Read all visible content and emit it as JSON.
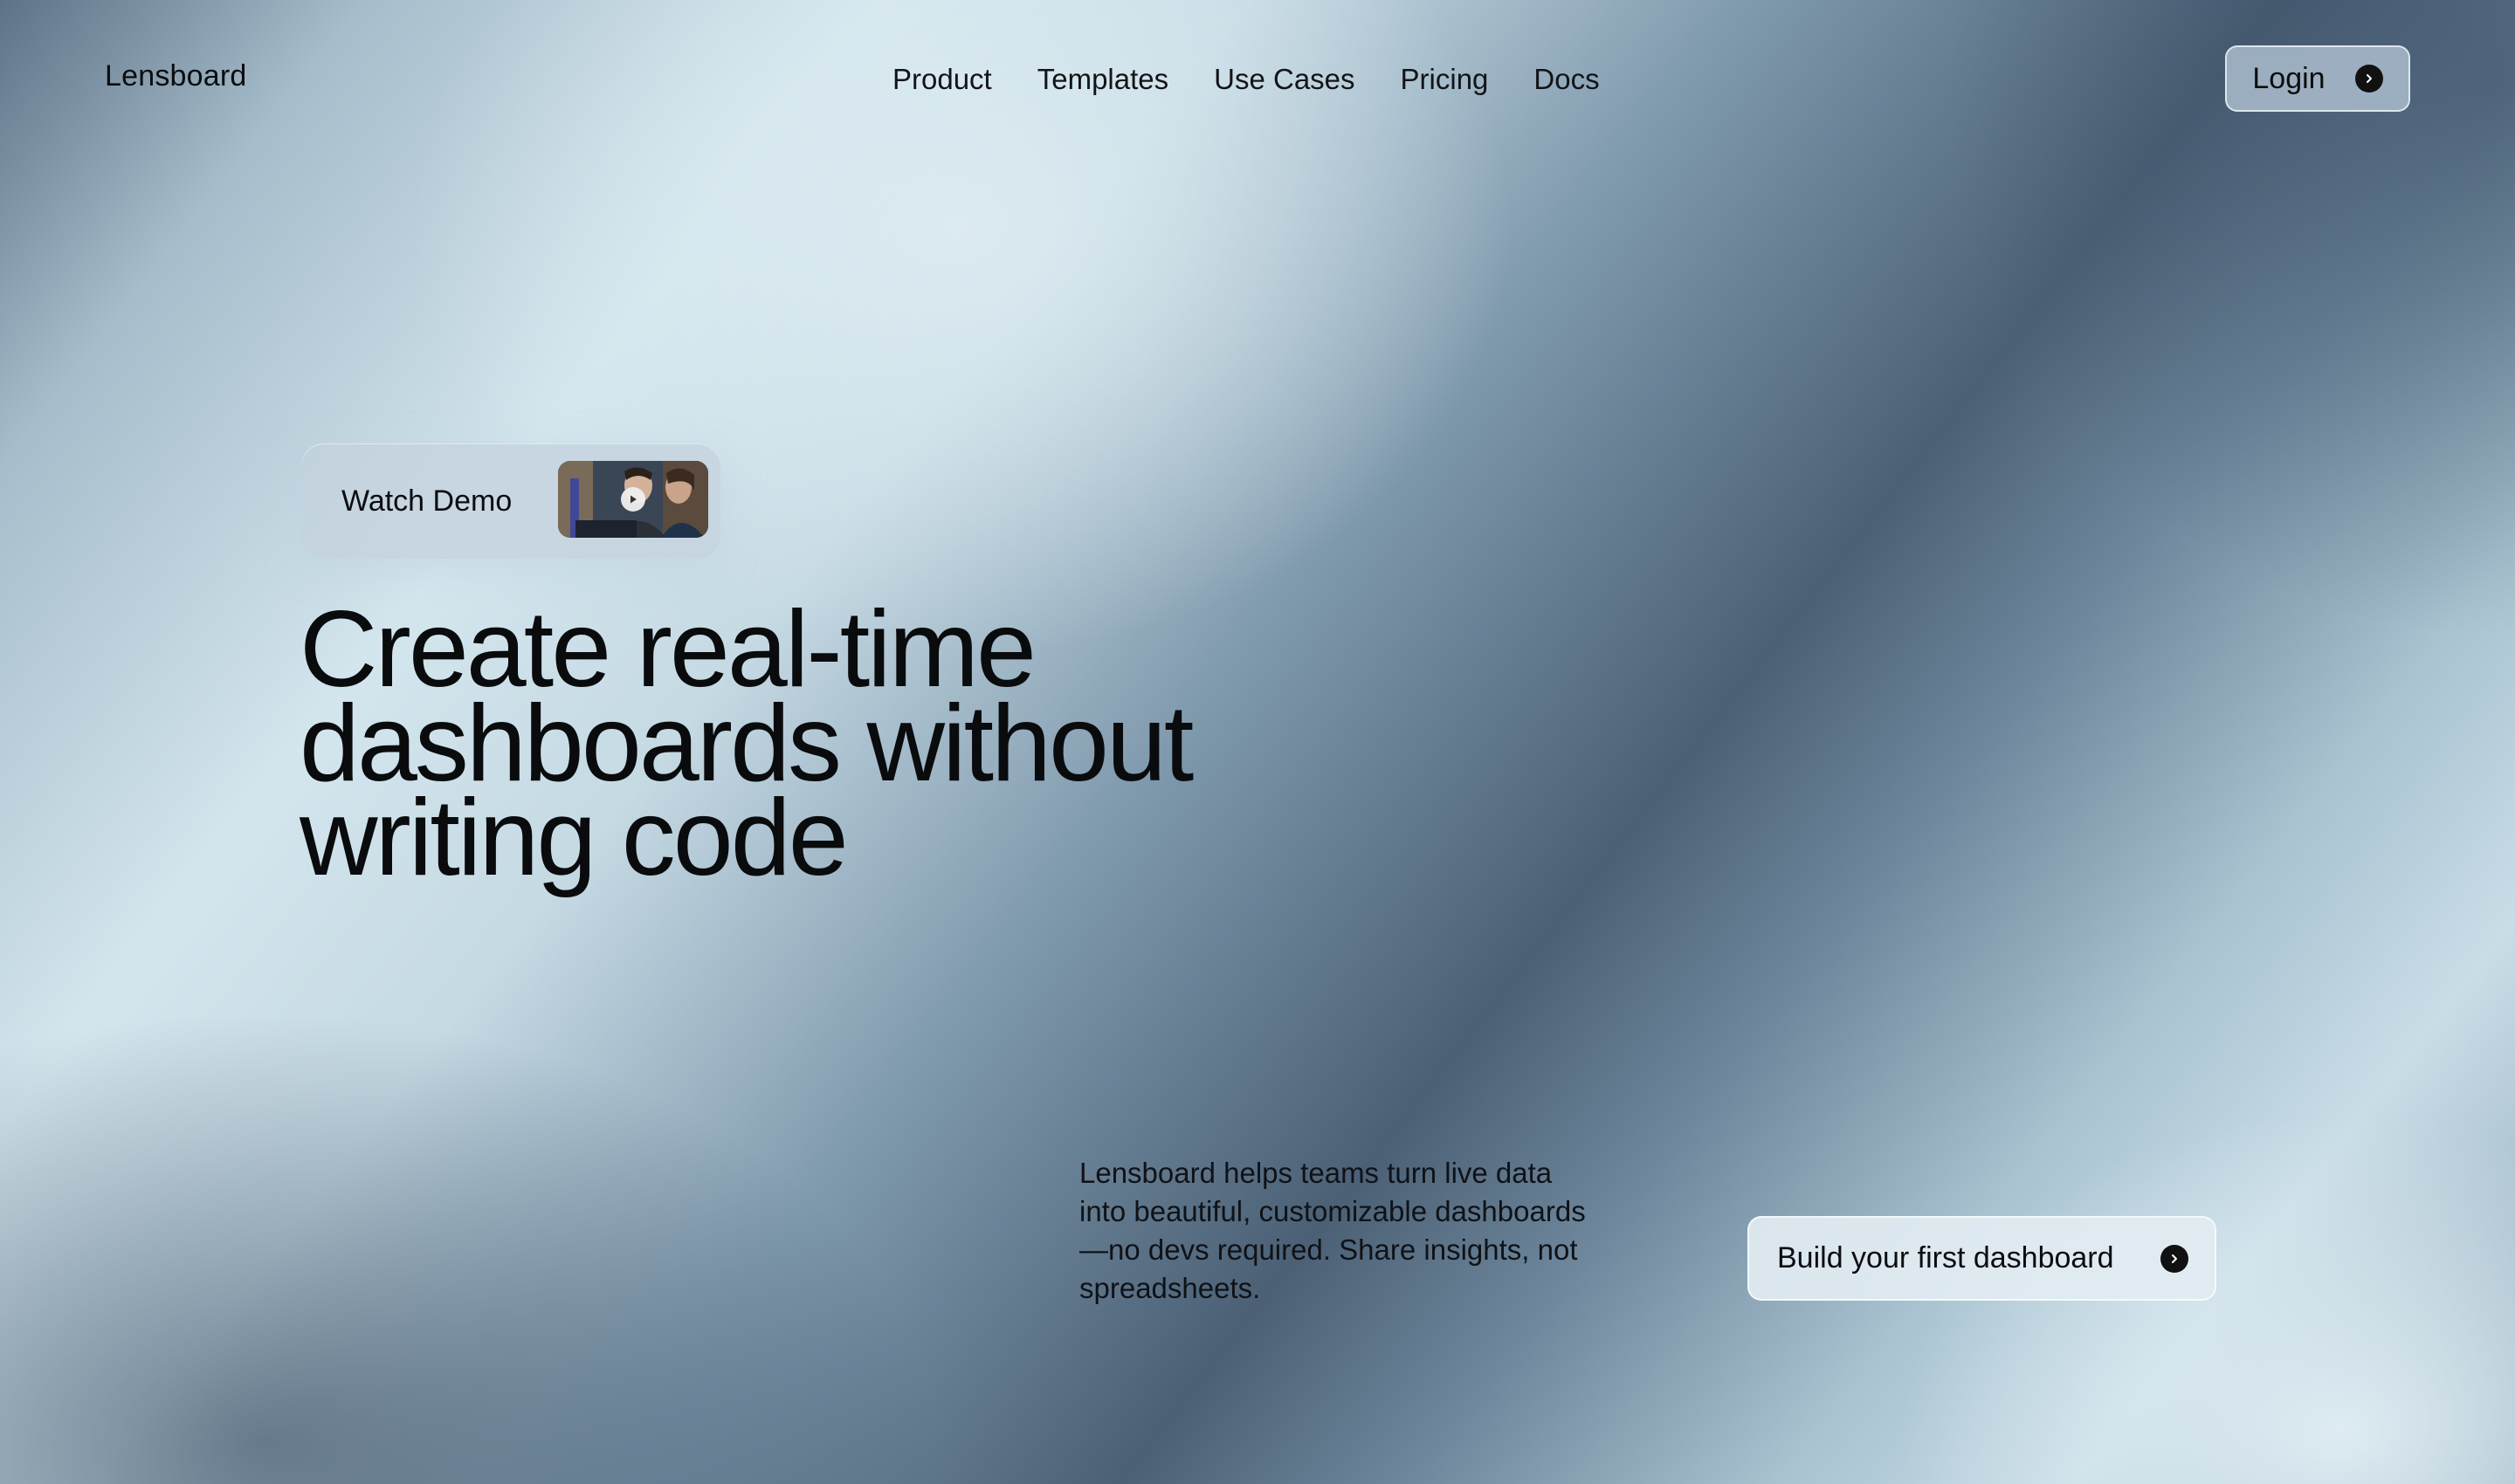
{
  "header": {
    "brand": "Lensboard",
    "nav": [
      "Product",
      "Templates",
      "Use Cases",
      "Pricing",
      "Docs"
    ],
    "login_label": "Login"
  },
  "hero": {
    "demo_label": "Watch Demo",
    "headline_lines": [
      "Create real-time",
      "dashboards without",
      "writing code"
    ],
    "description_lines": [
      "Lensboard helps teams turn live data",
      "into beautiful, customizable dashboards",
      "—no devs required. Share insights, not",
      "spreadsheets."
    ],
    "cta_label": "Build your first dashboard"
  },
  "icons": {
    "login": "arrow-right-circle-icon",
    "cta": "arrow-right-circle-icon",
    "demo": "play-icon"
  }
}
